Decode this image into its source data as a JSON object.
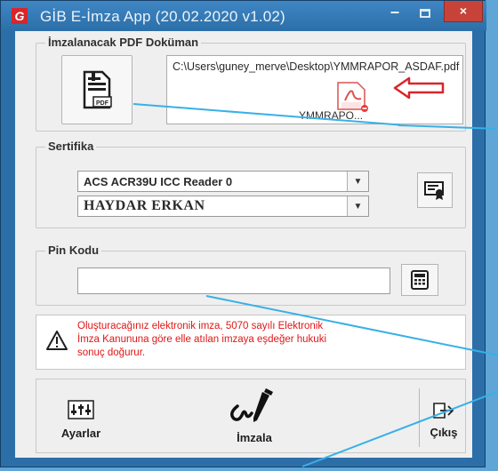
{
  "window": {
    "title": "GİB E-İmza App (20.02.2020 v1.02)",
    "app_icon_letter": "G",
    "minimize": "–",
    "close": "×"
  },
  "pdf_section": {
    "legend": "İmzalanacak PDF Doküman",
    "path_text": "C:\\Users\\guney_merve\\Desktop\\YMMRAPOR_ASDAF.pdf",
    "file_caption": "YMMRAPO...",
    "pdf_icon_label": "PDF"
  },
  "certificate_section": {
    "legend": "Sertifika",
    "reader_value": "ACS ACR39U ICC Reader 0",
    "holder_value": "HAYDAR ERKAN"
  },
  "pin_section": {
    "legend": "Pin Kodu",
    "value": ""
  },
  "warning": {
    "text": "Oluşturacağınız elektronik imza, 5070 sayılı Elektronik İmza Kanununa göre elle atılan imzaya eşdeğer hukuki sonuç doğurur."
  },
  "actions": {
    "settings_label": "Ayarlar",
    "sign_label": "İmzala",
    "exit_label": "Çıkış"
  },
  "colors": {
    "titlebar": "#2c6fa8",
    "close_button": "#c7433a",
    "warning_text": "#e01616",
    "annotation_arrow": "#d8262b",
    "annotation_lines": "#38b0e6"
  }
}
